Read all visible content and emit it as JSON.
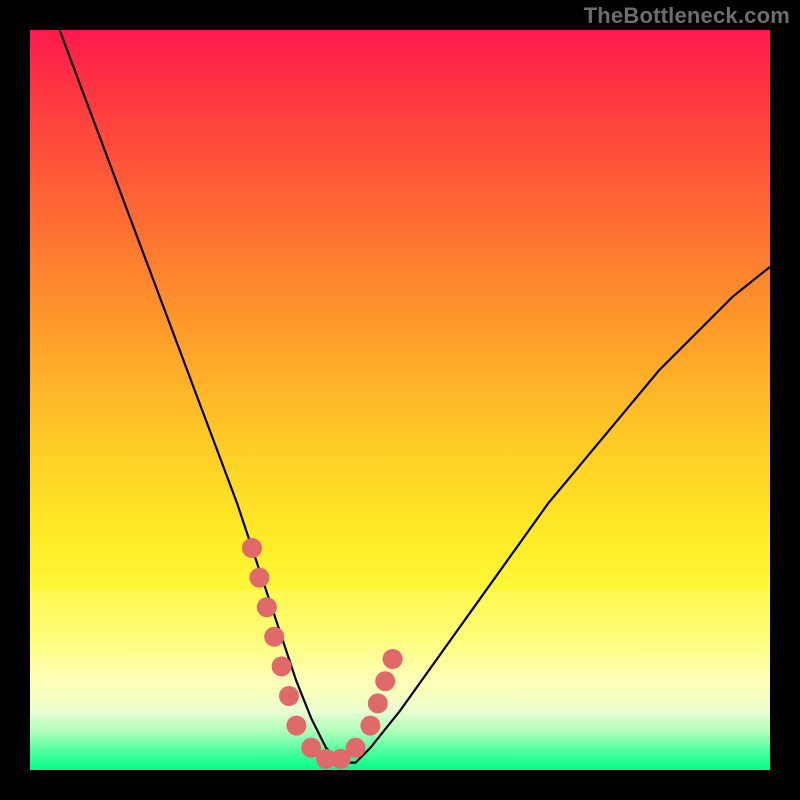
{
  "watermark": "TheBottleneck.com",
  "chart_data": {
    "type": "line",
    "title": "",
    "xlabel": "",
    "ylabel": "",
    "xlim": [
      0,
      100
    ],
    "ylim": [
      0,
      100
    ],
    "grid": false,
    "legend": false,
    "series": [
      {
        "name": "bottleneck-curve",
        "x": [
          4,
          7,
          10,
          13,
          16,
          19,
          22,
          25,
          28,
          30,
          32,
          34,
          36,
          38,
          40,
          42,
          44,
          46,
          50,
          55,
          60,
          65,
          70,
          75,
          80,
          85,
          90,
          95,
          100
        ],
        "y": [
          100,
          92,
          84,
          76,
          68,
          60,
          52,
          44,
          36,
          30,
          24,
          18,
          12,
          7,
          3,
          1,
          1,
          3,
          8,
          15,
          22,
          29,
          36,
          42,
          48,
          54,
          59,
          64,
          68
        ]
      }
    ],
    "highlight_points": {
      "name": "marker-dots",
      "color_hex": "#e06a6a",
      "points": [
        {
          "x": 30,
          "y": 30
        },
        {
          "x": 31,
          "y": 26
        },
        {
          "x": 32,
          "y": 22
        },
        {
          "x": 33,
          "y": 18
        },
        {
          "x": 34,
          "y": 14
        },
        {
          "x": 35,
          "y": 10
        },
        {
          "x": 36,
          "y": 6
        },
        {
          "x": 38,
          "y": 3
        },
        {
          "x": 40,
          "y": 1.5
        },
        {
          "x": 42,
          "y": 1.5
        },
        {
          "x": 44,
          "y": 3
        },
        {
          "x": 46,
          "y": 6
        },
        {
          "x": 47,
          "y": 9
        },
        {
          "x": 48,
          "y": 12
        },
        {
          "x": 49,
          "y": 15
        }
      ]
    },
    "background_gradient": {
      "type": "vertical",
      "stops": [
        {
          "pos": 0.0,
          "color": "#ff1a4d"
        },
        {
          "pos": 0.5,
          "color": "#ffc926"
        },
        {
          "pos": 0.88,
          "color": "#ffffb0"
        },
        {
          "pos": 1.0,
          "color": "#00ff88"
        }
      ]
    }
  }
}
